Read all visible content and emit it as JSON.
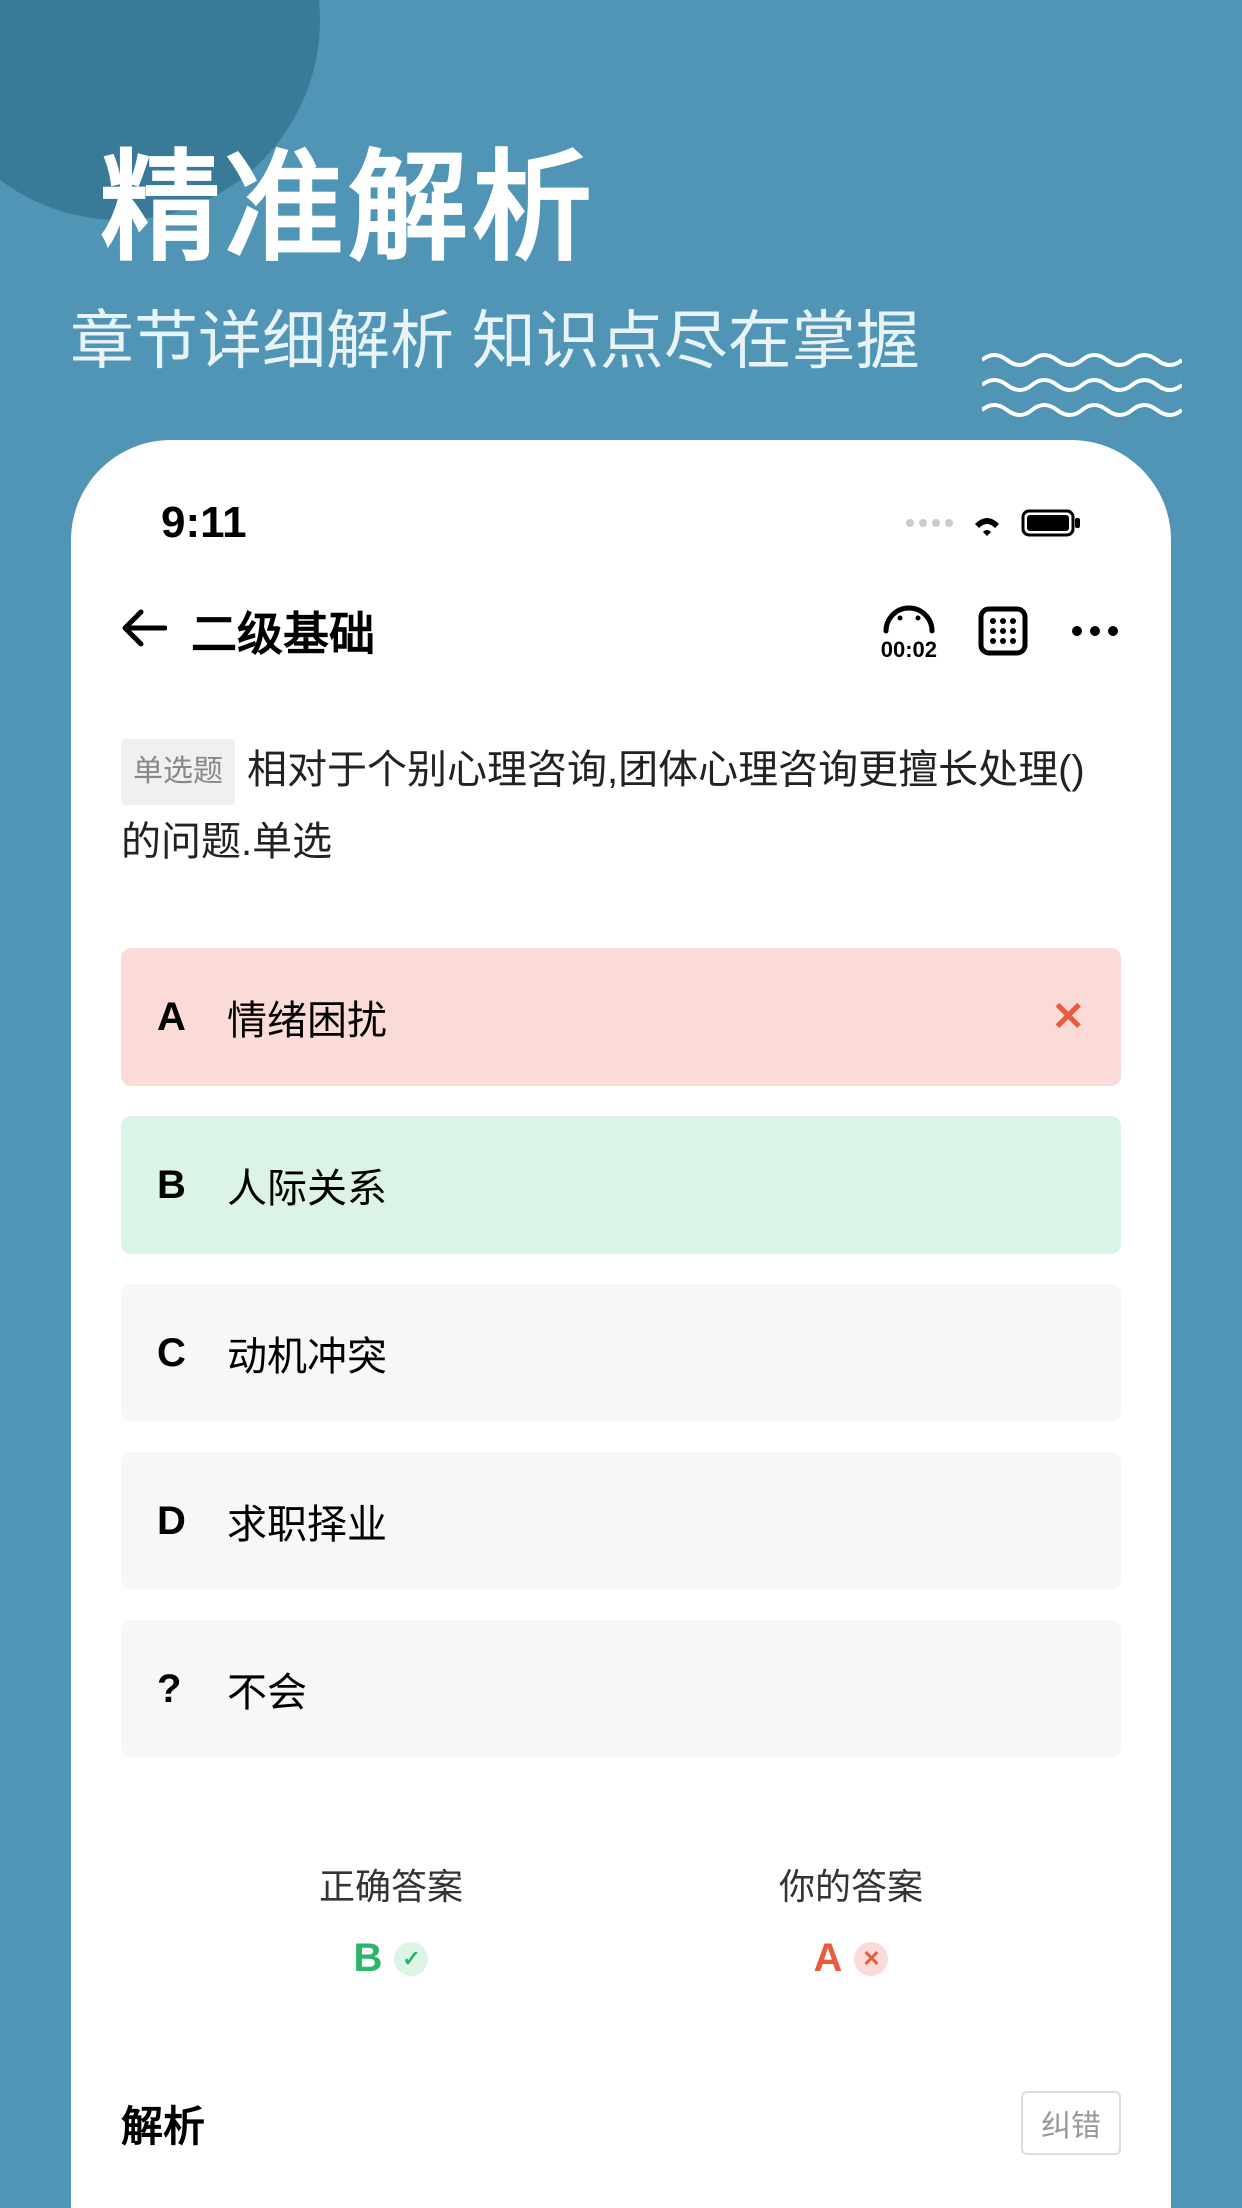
{
  "hero": {
    "title": "精准解析",
    "subtitle": "章节详细解析 知识点尽在掌握"
  },
  "status": {
    "time": "9:11"
  },
  "nav": {
    "title": "二级基础",
    "timer": "00:02"
  },
  "question": {
    "type_badge": "单选题",
    "text": "相对于个别心理咨询,团体心理咨询更擅长处理()的问题.单选"
  },
  "options": [
    {
      "letter": "A",
      "text": "情绪困扰",
      "state": "wrong",
      "mark": "✕"
    },
    {
      "letter": "B",
      "text": "人际关系",
      "state": "correct",
      "mark": ""
    },
    {
      "letter": "C",
      "text": "动机冲突",
      "state": "",
      "mark": ""
    },
    {
      "letter": "D",
      "text": "求职择业",
      "state": "",
      "mark": ""
    },
    {
      "letter": "?",
      "text": "不会",
      "state": "",
      "mark": ""
    }
  ],
  "answers": {
    "correct_label": "正确答案",
    "correct_value": "B",
    "your_label": "你的答案",
    "your_value": "A"
  },
  "footer": {
    "analysis": "解析",
    "report": "纠错"
  }
}
